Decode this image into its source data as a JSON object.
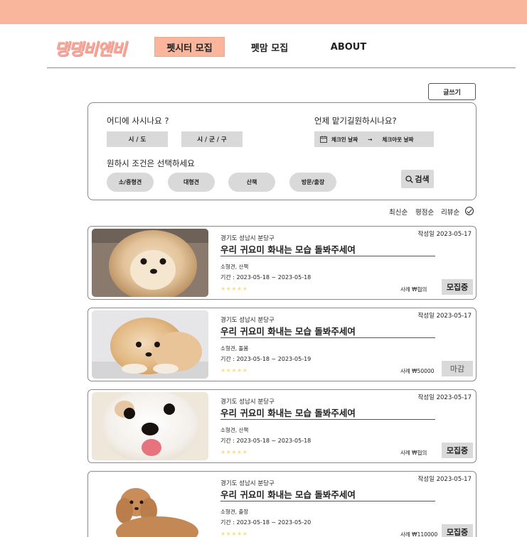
{
  "header": {
    "logo_text": "댕댕비앤비",
    "nav": [
      {
        "label": "펫시터 모집",
        "active": true
      },
      {
        "label": "펫맘 모집",
        "active": false
      },
      {
        "label": "ABOUT",
        "active": false
      }
    ]
  },
  "write_button": "글쓰기",
  "filter": {
    "where_label": "어디에 사시나요 ?",
    "city_button": "시 / 도",
    "district_button": "시 / 군 / 구",
    "when_label": "언제 맡기길원하시나요?",
    "checkin_label": "체크인 날짜",
    "arrow": "→",
    "checkout_label": "체크아웃 날짜",
    "condition_label": "원하시 조건은 선택하세요",
    "pills": [
      "소/중형견",
      "대형견",
      "산책",
      "방문/출장"
    ],
    "search_label": "검색"
  },
  "sort": {
    "latest": "최신순",
    "rating": "평점순",
    "review": "리뷰순"
  },
  "colors": {
    "accent": "#f9b69c",
    "button_gray": "#d9d9d9",
    "star": "#f5e08a"
  },
  "posts": [
    {
      "location": "경기도 성남시 분당구",
      "date": "작성일 2023-05-17",
      "title": "우리 귀요미 화내는 모습 돌봐주세여",
      "tags": "소형견, 산책",
      "period": "기간 : 2023-05-18 ~ 2023-05-18",
      "stars": "★★★★★",
      "price": "사례 ₩협의",
      "status": "모집중"
    },
    {
      "location": "경기도 성남시 분당구",
      "date": "작성일 2023-05-17",
      "title": "우리 귀요미 화내는 모습 돌봐주세여",
      "tags": "소형견, 돌봄",
      "period": "기간 : 2023-05-18 ~ 2023-05-19",
      "stars": "★★★★★",
      "price": "사례 ₩50000",
      "status": "마감"
    },
    {
      "location": "경기도 성남시 분당구",
      "date": "작성일 2023-05-17",
      "title": "우리 귀요미 화내는 모습 돌봐주세여",
      "tags": "소형견, 산책",
      "period": "기간 : 2023-05-18 ~ 2023-05-18",
      "stars": "★★★★★",
      "price": "사례 ₩협의",
      "status": "모집중"
    },
    {
      "location": "경기도 성남시 분당구",
      "date": "작성일 2023-05-17",
      "title": "우리 귀요미 화내는 모습 돌봐주세여",
      "tags": "소형견, 출장",
      "period": "기간 : 2023-05-18 ~ 2023-05-20",
      "stars": "★★★★★",
      "price": "사례 ₩110000",
      "status": "모집중"
    }
  ]
}
